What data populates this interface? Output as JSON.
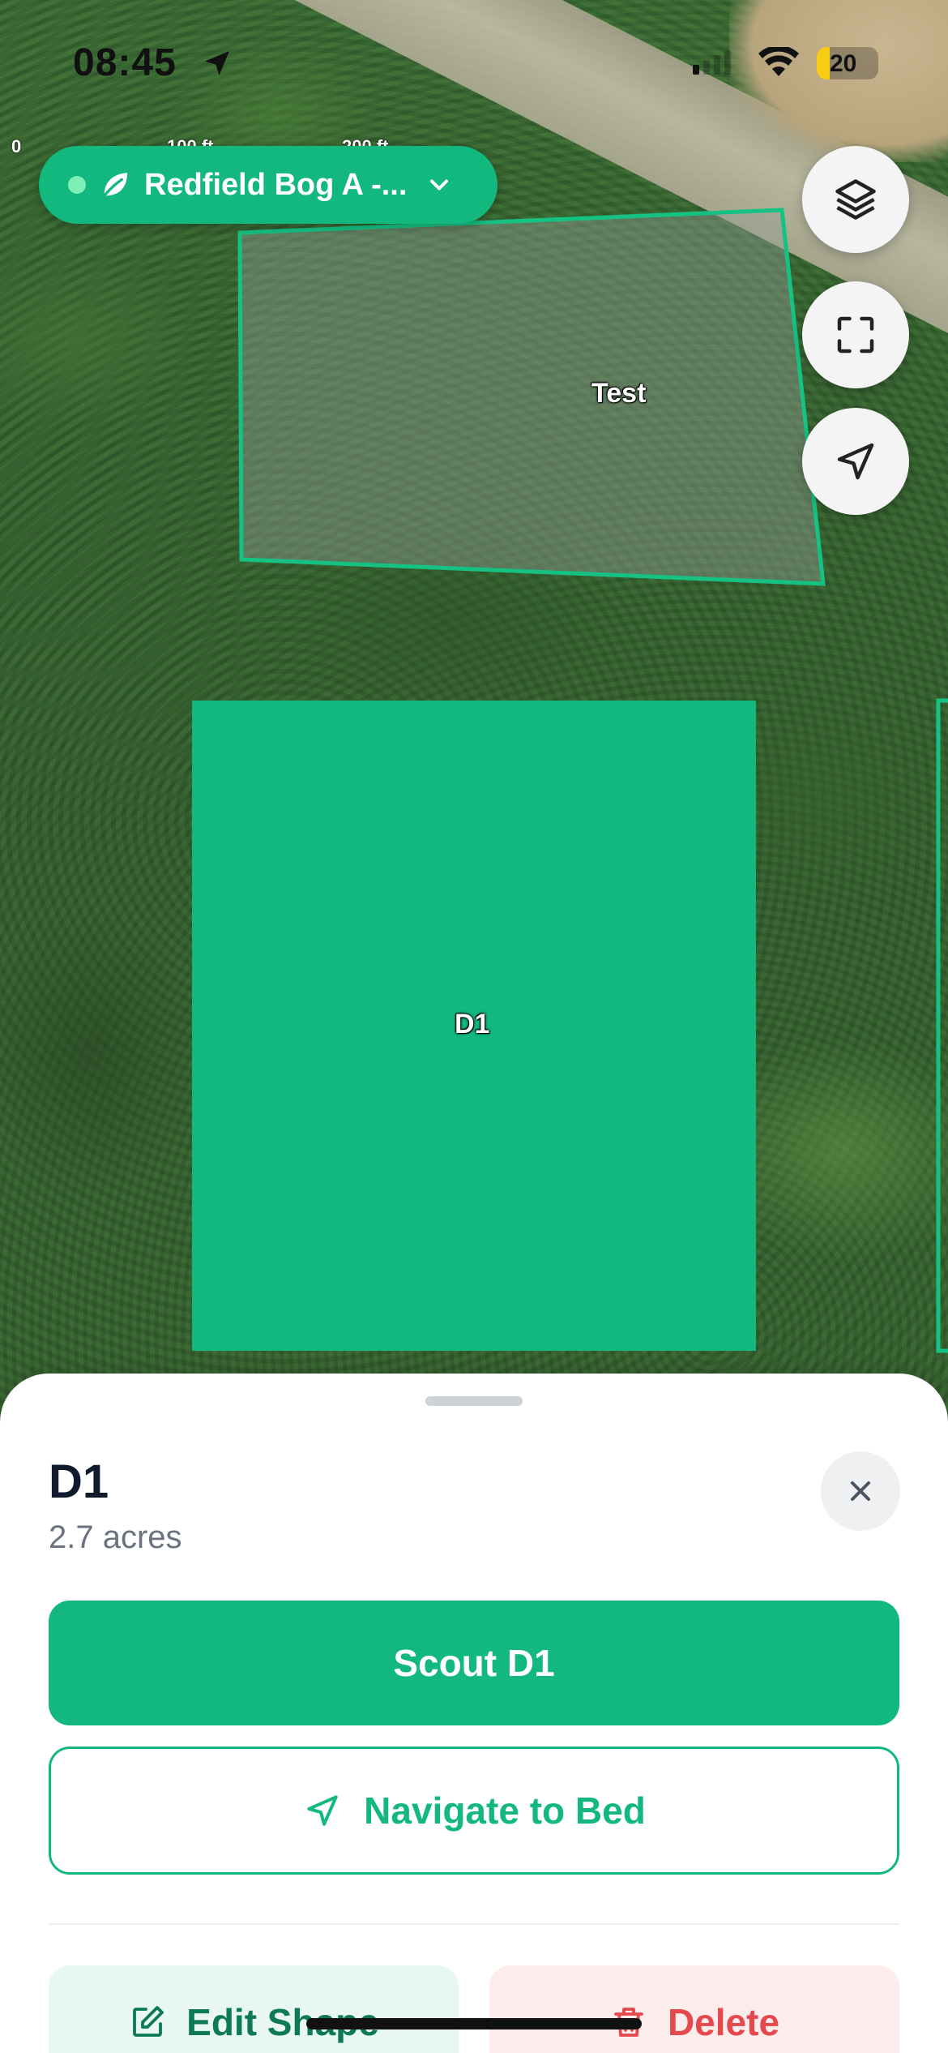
{
  "status_bar": {
    "time": "08:45",
    "battery": "20",
    "icons": [
      "location-arrow-icon",
      "cellular-signal-icon",
      "wifi-icon",
      "battery-icon"
    ]
  },
  "map": {
    "scale_labels": [
      "0",
      "100 ft",
      "200 ft"
    ],
    "farm_selector": {
      "label": "Redfield Bog A -...",
      "status_color": "#7df0b8",
      "icons": [
        "status-dot",
        "leaf-icon",
        "chevron-down-icon"
      ]
    },
    "controls": [
      {
        "name": "layers-button",
        "icon": "layers-icon"
      },
      {
        "name": "fit-bounds-button",
        "icon": "frame-corners-icon"
      },
      {
        "name": "locate-me-button",
        "icon": "navigation-arrow-icon"
      }
    ],
    "beds": [
      {
        "name": "Test",
        "selected": false
      },
      {
        "name": "D1",
        "selected": true
      }
    ]
  },
  "sheet": {
    "title": "D1",
    "area": "2.7 acres",
    "scout_label": "Scout D1",
    "navigate_label": "Navigate to Bed",
    "edit_label": "Edit Shape",
    "delete_label": "Delete"
  },
  "colors": {
    "brand_green": "#13b87e",
    "danger_red": "#e5484d",
    "title_text": "#0f1b2d",
    "muted_text": "#6b7280"
  }
}
